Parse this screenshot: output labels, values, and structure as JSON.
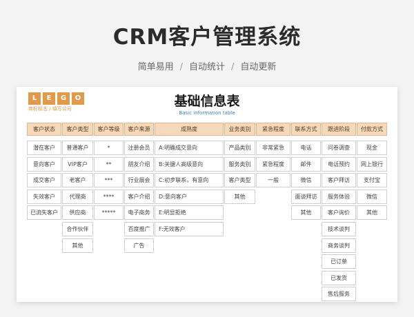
{
  "hero": {
    "title": "CRM客户管理系统",
    "subtitle_parts": [
      "简单易用",
      "自动统计",
      "自动更新"
    ]
  },
  "sheet": {
    "logo_cells": [
      "L",
      "E",
      "G",
      "O"
    ],
    "logo_tag": "商标标志 / 填写公司",
    "title": "基础信息表",
    "subtitle": "Basic information table"
  },
  "columns": [
    {
      "header": "客户状态",
      "align": "center",
      "cells": [
        "潜在客户",
        "意向客户",
        "成交客户",
        "失效客户",
        "已流失客户"
      ]
    },
    {
      "header": "客户类型",
      "align": "center",
      "cells": [
        "普通客户",
        "VIP客户",
        "老客户",
        "代理商",
        "供应商",
        "合作伙伴",
        "其他"
      ]
    },
    {
      "header": "客户等级",
      "align": "center",
      "cells": [
        "*",
        "**",
        "***",
        "****",
        "*****"
      ]
    },
    {
      "header": "客户来源",
      "align": "center",
      "cells": [
        "注册会员",
        "朋友介绍",
        "行业展会",
        "客户介绍",
        "电子商务",
        "百度推广",
        "广告"
      ]
    },
    {
      "header": "成熟度",
      "align": "left",
      "cells": [
        "A:明确成交意向",
        "B:关键人高级意向",
        "C:初步联系，有意向",
        "D:意向客户",
        "E:明显拒绝",
        "F:无效客户"
      ]
    },
    {
      "header": "业务类别",
      "align": "center",
      "cells": [
        "产品类别",
        "服务类别",
        "客户类型",
        "其他"
      ]
    },
    {
      "header": "紧急程度",
      "align": "center",
      "cells": [
        "非常紧急",
        "紧急程度",
        "一般"
      ]
    },
    {
      "header": "联系方式",
      "align": "center",
      "cells": [
        "电话",
        "邮件",
        "微信",
        "面谈拜访",
        "其他"
      ]
    },
    {
      "header": "跟进阶段",
      "align": "center",
      "cells": [
        "问卷调查",
        "电话预约",
        "客户拜访",
        "服务体验",
        "客户询价",
        "技术谈判",
        "商务谈判",
        "已订单",
        "已发货",
        "售后服务"
      ]
    },
    {
      "header": "付款方式",
      "align": "center",
      "cells": [
        "现金",
        "网上银行",
        "支付宝",
        "微信",
        "其他"
      ]
    }
  ],
  "colors": {
    "header_bg": "#f6d8bb",
    "accent": "#e29a4a",
    "subtitle_blue": "#3b82c6"
  }
}
